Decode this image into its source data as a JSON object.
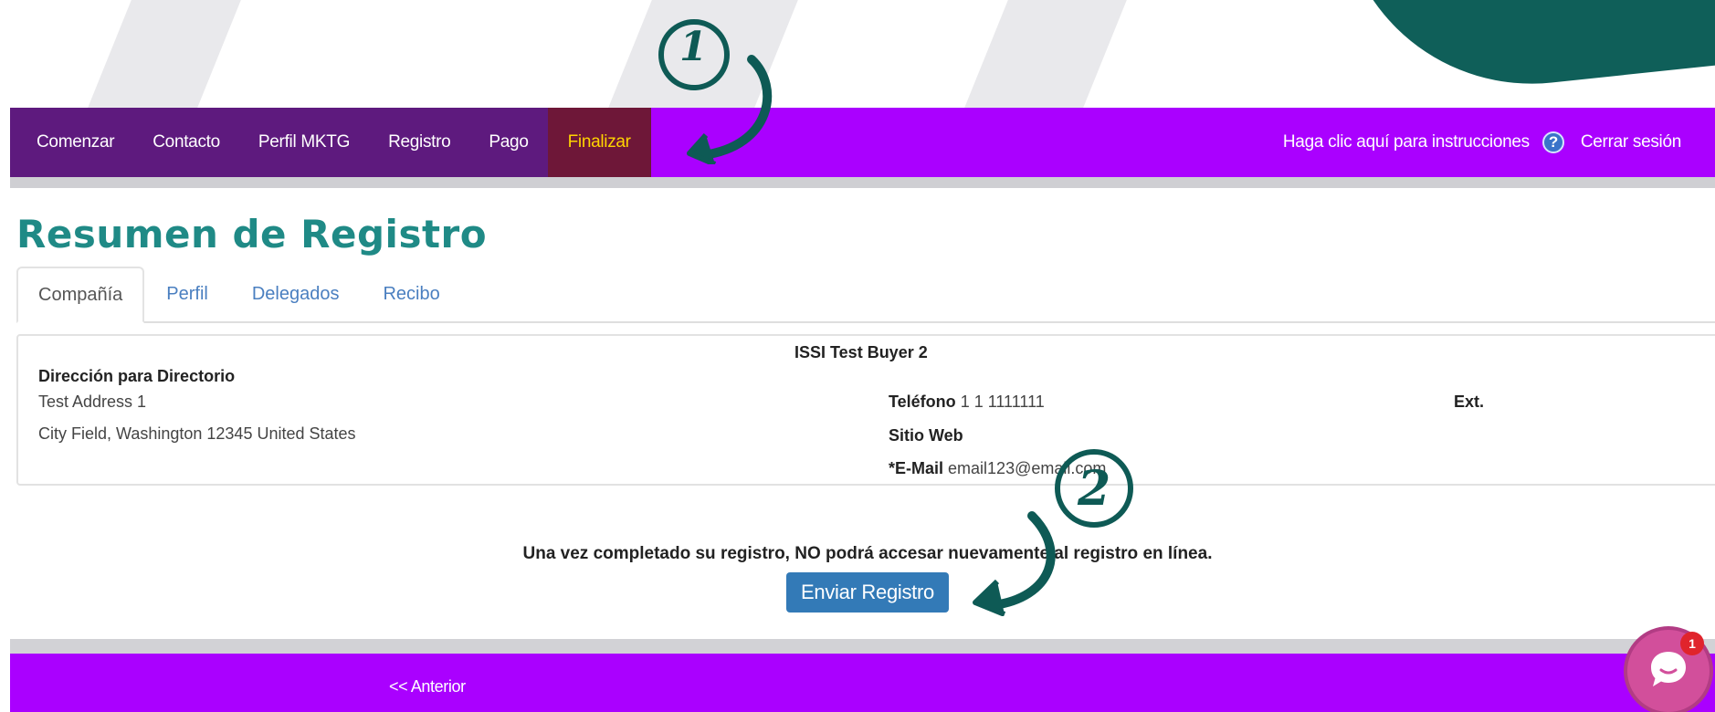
{
  "nav": {
    "items": [
      {
        "label": "Comenzar"
      },
      {
        "label": "Contacto"
      },
      {
        "label": "Perfil MKTG"
      },
      {
        "label": "Registro"
      },
      {
        "label": "Pago"
      },
      {
        "label": "Finalizar",
        "active": true
      }
    ],
    "instructions": "Haga clic aquí para instrucciones",
    "help_icon": "?",
    "logout": "Cerrar sesión"
  },
  "page": {
    "title": "Resumen de Registro"
  },
  "tabs": [
    {
      "label": "Compañía",
      "active": true
    },
    {
      "label": "Perfil"
    },
    {
      "label": "Delegados"
    },
    {
      "label": "Recibo"
    }
  ],
  "company": {
    "name": "ISSI Test Buyer 2",
    "directory_address_label": "Dirección para Directorio",
    "address_line1": "Test Address 1",
    "address_line2": "City Field,  Washington  12345  United States",
    "phone_label": "Teléfono",
    "phone_value": "1 1 1111111",
    "ext_label": "Ext.",
    "website_label": "Sitio Web",
    "email_label": "*E-Mail",
    "email_value": "email123@email.com"
  },
  "notice": "Una vez completado su registro, NO podrá accesar nuevamente al registro en línea.",
  "submit_button": "Enviar Registro",
  "footer": {
    "previous": "<< Anterior"
  },
  "chat": {
    "badge": "1"
  },
  "annotations": {
    "step1": "1",
    "step2": "2"
  },
  "colors": {
    "nav_bar": "#aa00ff",
    "nav_group": "#5e1a7e",
    "nav_active": "#6e1738",
    "nav_active_text": "#ffd400",
    "title": "#1f8a86",
    "button": "#337ab7",
    "annotation": "#0e5a55"
  }
}
